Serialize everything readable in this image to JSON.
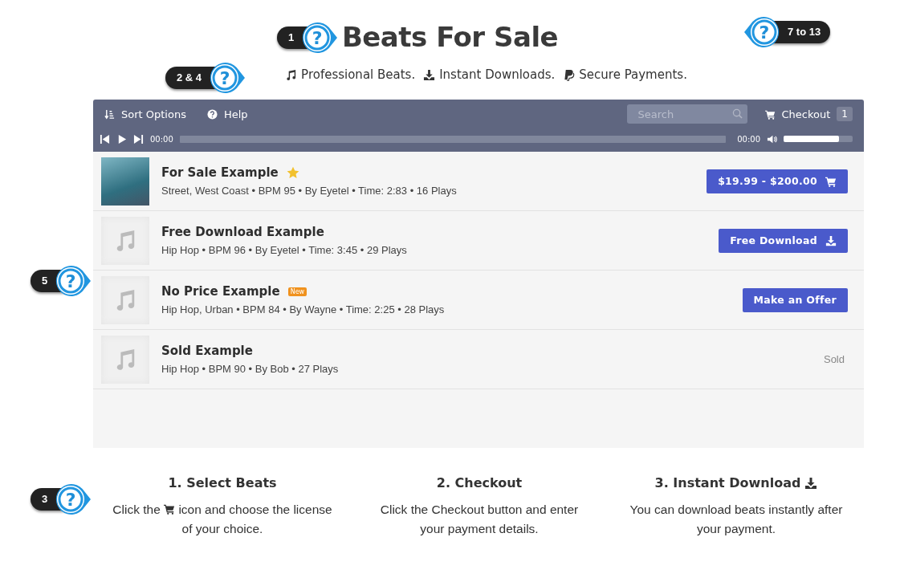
{
  "title": "Beats For Sale",
  "taglines": [
    {
      "kind": "music",
      "text": "Professional Beats."
    },
    {
      "kind": "download",
      "text": "Instant Downloads."
    },
    {
      "kind": "paypal",
      "text": "Secure Payments."
    }
  ],
  "callouts": [
    {
      "label": "1",
      "mark": "?"
    },
    {
      "label": "7 to 13",
      "mark": "?"
    },
    {
      "label": "2 & 4",
      "mark": "?"
    },
    {
      "label": "5",
      "mark": "?"
    },
    {
      "label": "3",
      "mark": "?"
    }
  ],
  "toolbar": {
    "sort": "Sort Options",
    "help": "Help",
    "search_placeholder": "Search",
    "checkout": "Checkout",
    "checkout_count": "1"
  },
  "player": {
    "elapsed": "00:00",
    "duration": "00:00",
    "volume": {
      "level": 0.8
    }
  },
  "tracks": [
    {
      "title": "For Sale Example",
      "badge": {
        "kind": "star"
      },
      "artwork": {
        "kind": "photo"
      },
      "meta": "Street, West Coast • BPM 95 • By Eyetel • Time: 2:83 • 16 Plays",
      "action": {
        "kind": "price",
        "label": "$19.99 - $200.00"
      }
    },
    {
      "title": "Free Download Example",
      "artwork": {
        "kind": "note"
      },
      "meta": "Hip Hop • BPM 96 • By Eyetel • Time: 3:45 • 29 Plays",
      "action": {
        "kind": "download",
        "label": "Free Download"
      }
    },
    {
      "title": "No Price Example",
      "badge": {
        "kind": "new",
        "text": "New"
      },
      "artwork": {
        "kind": "note"
      },
      "meta": "Hip Hop, Urban • BPM 84 • By Wayne • Time: 2:25 • 28 Plays",
      "action": {
        "kind": "offer",
        "label": "Make an Offer"
      }
    },
    {
      "title": "Sold Example",
      "artwork": {
        "kind": "note"
      },
      "meta": "Hip Hop • BPM 90 • By Bob • 27 Plays",
      "action": {
        "kind": "sold",
        "label": "Sold"
      }
    }
  ],
  "steps": [
    {
      "heading": "1. Select Beats",
      "kind": "select",
      "text_before": "Click the",
      "text_after": "icon and choose the license of your choice."
    },
    {
      "heading": "2. Checkout",
      "kind": "checkout",
      "text_before": "Click the Checkout button and enter your payment details."
    },
    {
      "heading": "3. Instant Download",
      "kind": "download",
      "text_before": "You can download beats instantly after your payment."
    }
  ]
}
